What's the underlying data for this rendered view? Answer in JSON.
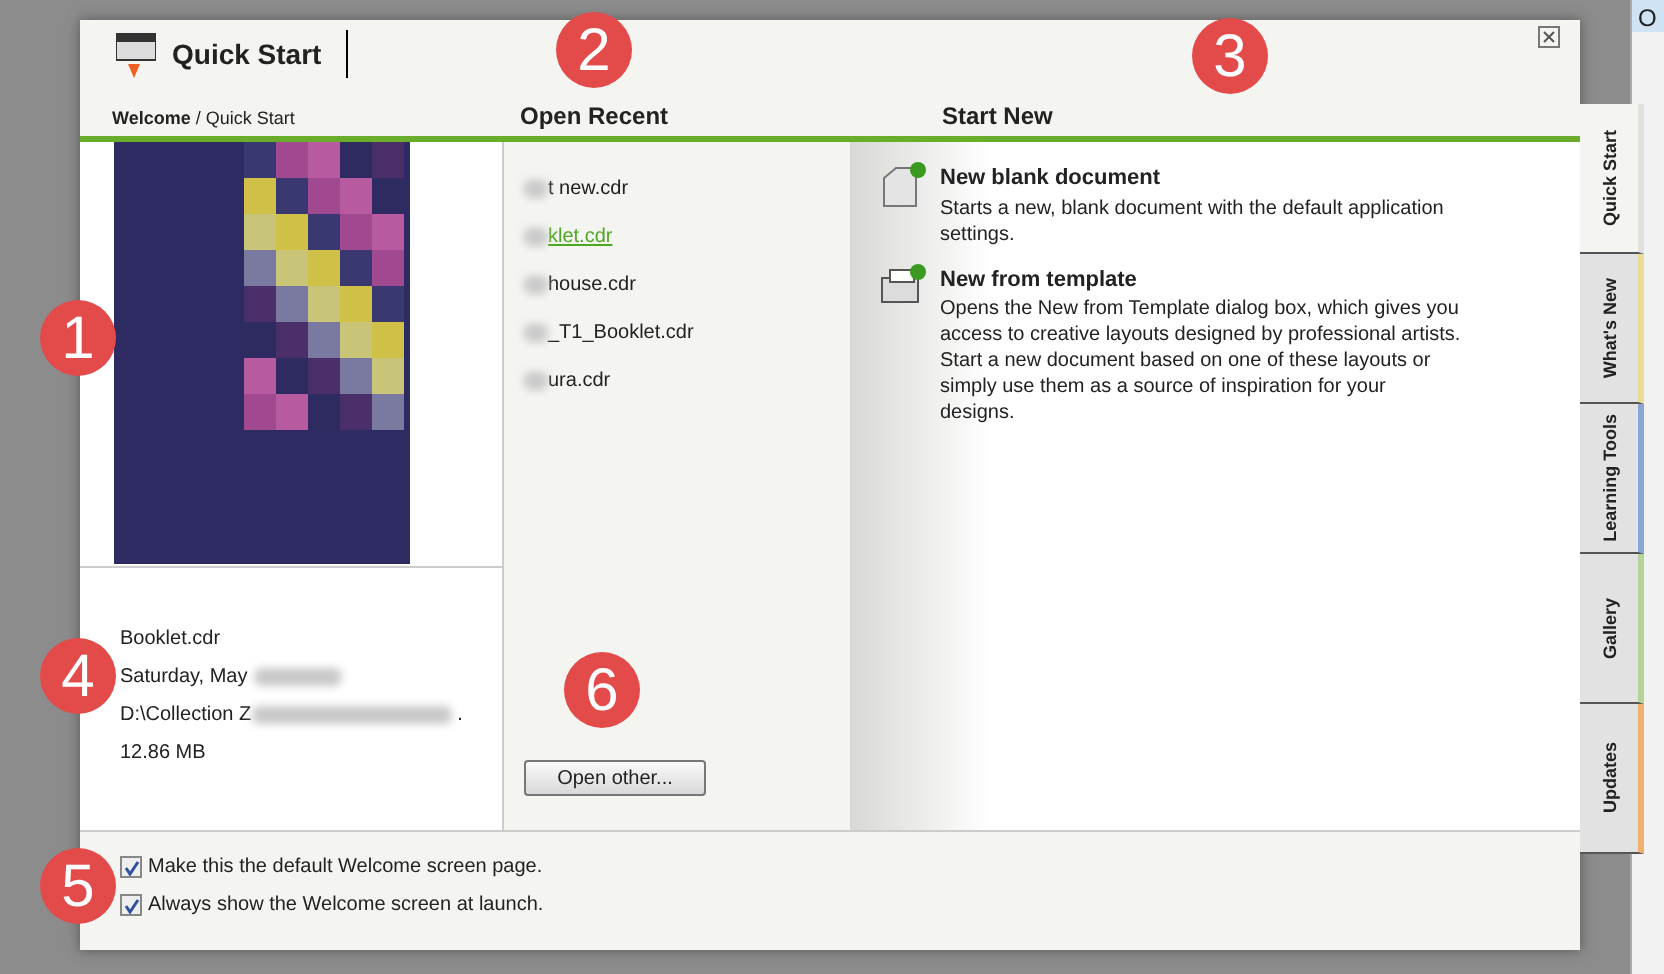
{
  "header": {
    "title": "Quick Start",
    "breadcrumb_root": "Welcome",
    "breadcrumb_separator": "/",
    "breadcrumb_current": "Quick Start"
  },
  "preview": {
    "file_name": "Booklet.cdr",
    "date": "Saturday, May",
    "path_start": "D:\\Collection Z",
    "path_end": ".",
    "size": "12.86 MB"
  },
  "open_recent": {
    "heading": "Open Recent",
    "files": [
      {
        "name": "t new.cdr",
        "selected": false
      },
      {
        "name": "klet.cdr",
        "selected": true
      },
      {
        "name": "house.cdr",
        "selected": false
      },
      {
        "name": "_T1_Booklet.cdr",
        "selected": false
      },
      {
        "name": "ura.cdr",
        "selected": false
      }
    ],
    "button": "Open other..."
  },
  "start_new": {
    "heading": "Start New",
    "items": [
      {
        "kind": "blank",
        "title": "New blank document",
        "description": "Starts a new, blank document with the default application settings."
      },
      {
        "kind": "template",
        "title": "New from template",
        "description": "Opens the New from Template dialog box, which gives you access to creative layouts designed by professional artists. Start a new document based on one of these layouts or simply use them as a source of inspiration for your designs."
      }
    ]
  },
  "options": [
    {
      "label": "Make this the default Welcome screen page.",
      "checked": true
    },
    {
      "label": "Always show the Welcome screen at launch.",
      "checked": true
    }
  ],
  "side_tabs": [
    {
      "label": "Quick Start",
      "selected": true,
      "color": "#e0e0e0"
    },
    {
      "label": "What's New",
      "selected": false,
      "color": "#e8dc98"
    },
    {
      "label": "Learning Tools",
      "selected": false,
      "color": "#8aa4d6"
    },
    {
      "label": "Gallery",
      "selected": false,
      "color": "#b6d39a"
    },
    {
      "label": "Updates",
      "selected": false,
      "color": "#f0b070"
    }
  ],
  "app_panel_label": "O",
  "callouts": [
    "1",
    "2",
    "3",
    "4",
    "5",
    "6"
  ]
}
